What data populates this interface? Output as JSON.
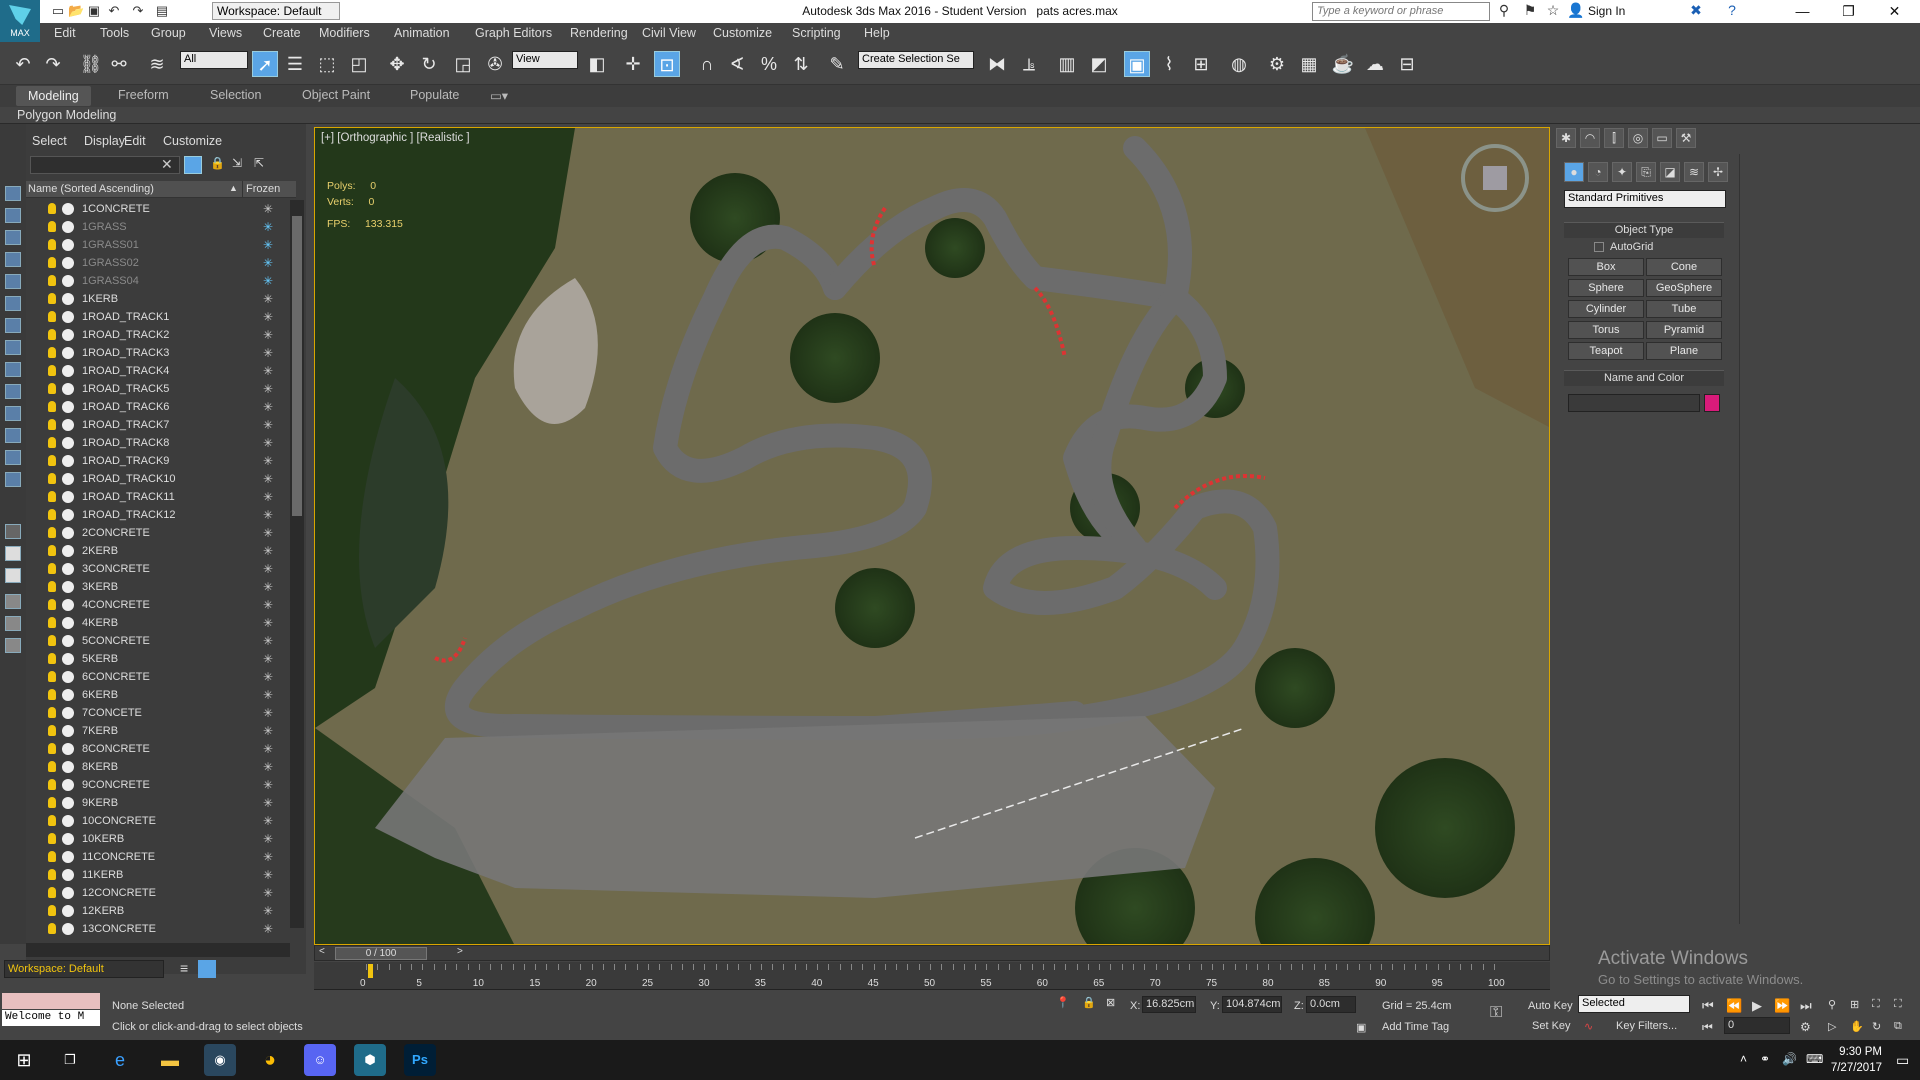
{
  "title": "Autodesk 3ds Max 2016 - Student Version",
  "filename": "pats acres.max",
  "logo_text": "MAX",
  "workspace": "Workspace: Default",
  "search_placeholder": "Type a keyword or phrase",
  "sign_in": "Sign In",
  "menus": [
    "Edit",
    "Tools",
    "Group",
    "Views",
    "Create",
    "Modifiers",
    "Animation",
    "Graph Editors",
    "Rendering",
    "Civil View",
    "Customize",
    "Scripting",
    "Help"
  ],
  "toolbar": {
    "filter": "All",
    "ref_coord": "View",
    "selection_set": "Create Selection Se"
  },
  "ribbon_tabs": [
    "Modeling",
    "Freeform",
    "Selection",
    "Object Paint",
    "Populate"
  ],
  "ribbon_active": "Modeling",
  "polygon_modeling": "Polygon Modeling",
  "scene_menus": [
    "Select",
    "Display",
    "Edit",
    "Customize"
  ],
  "scene_headers": {
    "name": "Name (Sorted Ascending)",
    "frozen": "Frozen"
  },
  "scene_items": [
    {
      "name": "1CONCRETE",
      "frozen": false
    },
    {
      "name": "1GRASS",
      "frozen": true
    },
    {
      "name": "1GRASS01",
      "frozen": true
    },
    {
      "name": "1GRASS02",
      "frozen": true
    },
    {
      "name": "1GRASS04",
      "frozen": true
    },
    {
      "name": "1KERB",
      "frozen": false
    },
    {
      "name": "1ROAD_TRACK1",
      "frozen": false
    },
    {
      "name": "1ROAD_TRACK2",
      "frozen": false
    },
    {
      "name": "1ROAD_TRACK3",
      "frozen": false
    },
    {
      "name": "1ROAD_TRACK4",
      "frozen": false
    },
    {
      "name": "1ROAD_TRACK5",
      "frozen": false
    },
    {
      "name": "1ROAD_TRACK6",
      "frozen": false
    },
    {
      "name": "1ROAD_TRACK7",
      "frozen": false
    },
    {
      "name": "1ROAD_TRACK8",
      "frozen": false
    },
    {
      "name": "1ROAD_TRACK9",
      "frozen": false
    },
    {
      "name": "1ROAD_TRACK10",
      "frozen": false
    },
    {
      "name": "1ROAD_TRACK11",
      "frozen": false
    },
    {
      "name": "1ROAD_TRACK12",
      "frozen": false
    },
    {
      "name": "2CONCRETE",
      "frozen": false
    },
    {
      "name": "2KERB",
      "frozen": false
    },
    {
      "name": "3CONCRETE",
      "frozen": false
    },
    {
      "name": "3KERB",
      "frozen": false
    },
    {
      "name": "4CONCRETE",
      "frozen": false
    },
    {
      "name": "4KERB",
      "frozen": false
    },
    {
      "name": "5CONCRETE",
      "frozen": false
    },
    {
      "name": "5KERB",
      "frozen": false
    },
    {
      "name": "6CONCRETE",
      "frozen": false
    },
    {
      "name": "6KERB",
      "frozen": false
    },
    {
      "name": "7CONCETE",
      "frozen": false
    },
    {
      "name": "7KERB",
      "frozen": false
    },
    {
      "name": "8CONCRETE",
      "frozen": false
    },
    {
      "name": "8KERB",
      "frozen": false
    },
    {
      "name": "9CONCRETE",
      "frozen": false
    },
    {
      "name": "9KERB",
      "frozen": false
    },
    {
      "name": "10CONCRETE",
      "frozen": false
    },
    {
      "name": "10KERB",
      "frozen": false
    },
    {
      "name": "11CONCRETE",
      "frozen": false
    },
    {
      "name": "11KERB",
      "frozen": false
    },
    {
      "name": "12CONCRETE",
      "frozen": false
    },
    {
      "name": "12KERB",
      "frozen": false
    },
    {
      "name": "13CONCRETE",
      "frozen": false
    }
  ],
  "viewport": {
    "label": "[+] [Orthographic ] [Realistic ]",
    "polys_label": "Polys:",
    "polys": "0",
    "verts_label": "Verts:",
    "verts": "0",
    "fps_label": "FPS:",
    "fps": "133.315"
  },
  "command_panel": {
    "category": "Standard Primitives",
    "object_type": "Object Type",
    "autogrid": "AutoGrid",
    "buttons": [
      "Box",
      "Cone",
      "Sphere",
      "GeoSphere",
      "Cylinder",
      "Tube",
      "Torus",
      "Pyramid",
      "Teapot",
      "Plane"
    ],
    "name_color": "Name and Color",
    "color": "#d81b7a"
  },
  "activate": {
    "title": "Activate Windows",
    "sub": "Go to Settings to activate Windows."
  },
  "time": {
    "frame": "0 / 100",
    "ticks": [
      "0",
      "5",
      "10",
      "15",
      "20",
      "25",
      "30",
      "35",
      "40",
      "45",
      "50",
      "55",
      "60",
      "65",
      "70",
      "75",
      "80",
      "85",
      "90",
      "95",
      "100"
    ]
  },
  "status": {
    "workspace": "Workspace: Default",
    "maxscript": "Welcome to M",
    "selection": "None Selected",
    "prompt": "Click or click-and-drag to select objects",
    "x_label": "X:",
    "x": "16.825cm",
    "y_label": "Y:",
    "y": "104.874cm",
    "z_label": "Z:",
    "z": "0.0cm",
    "grid": "Grid = 25.4cm",
    "add_time_tag": "Add Time Tag",
    "auto_key": "Auto Key",
    "set_key": "Set Key",
    "selected": "Selected",
    "key_filters": "Key Filters...",
    "frame_field": "0"
  },
  "clock": {
    "time": "9:30 PM",
    "date": "7/27/2017"
  },
  "taskbar_apps": [
    "cortana",
    "task-view",
    "edge",
    "file-explorer",
    "steam",
    "chrome",
    "discord",
    "3dsmax",
    "photoshop"
  ],
  "ps_label": "Ps"
}
